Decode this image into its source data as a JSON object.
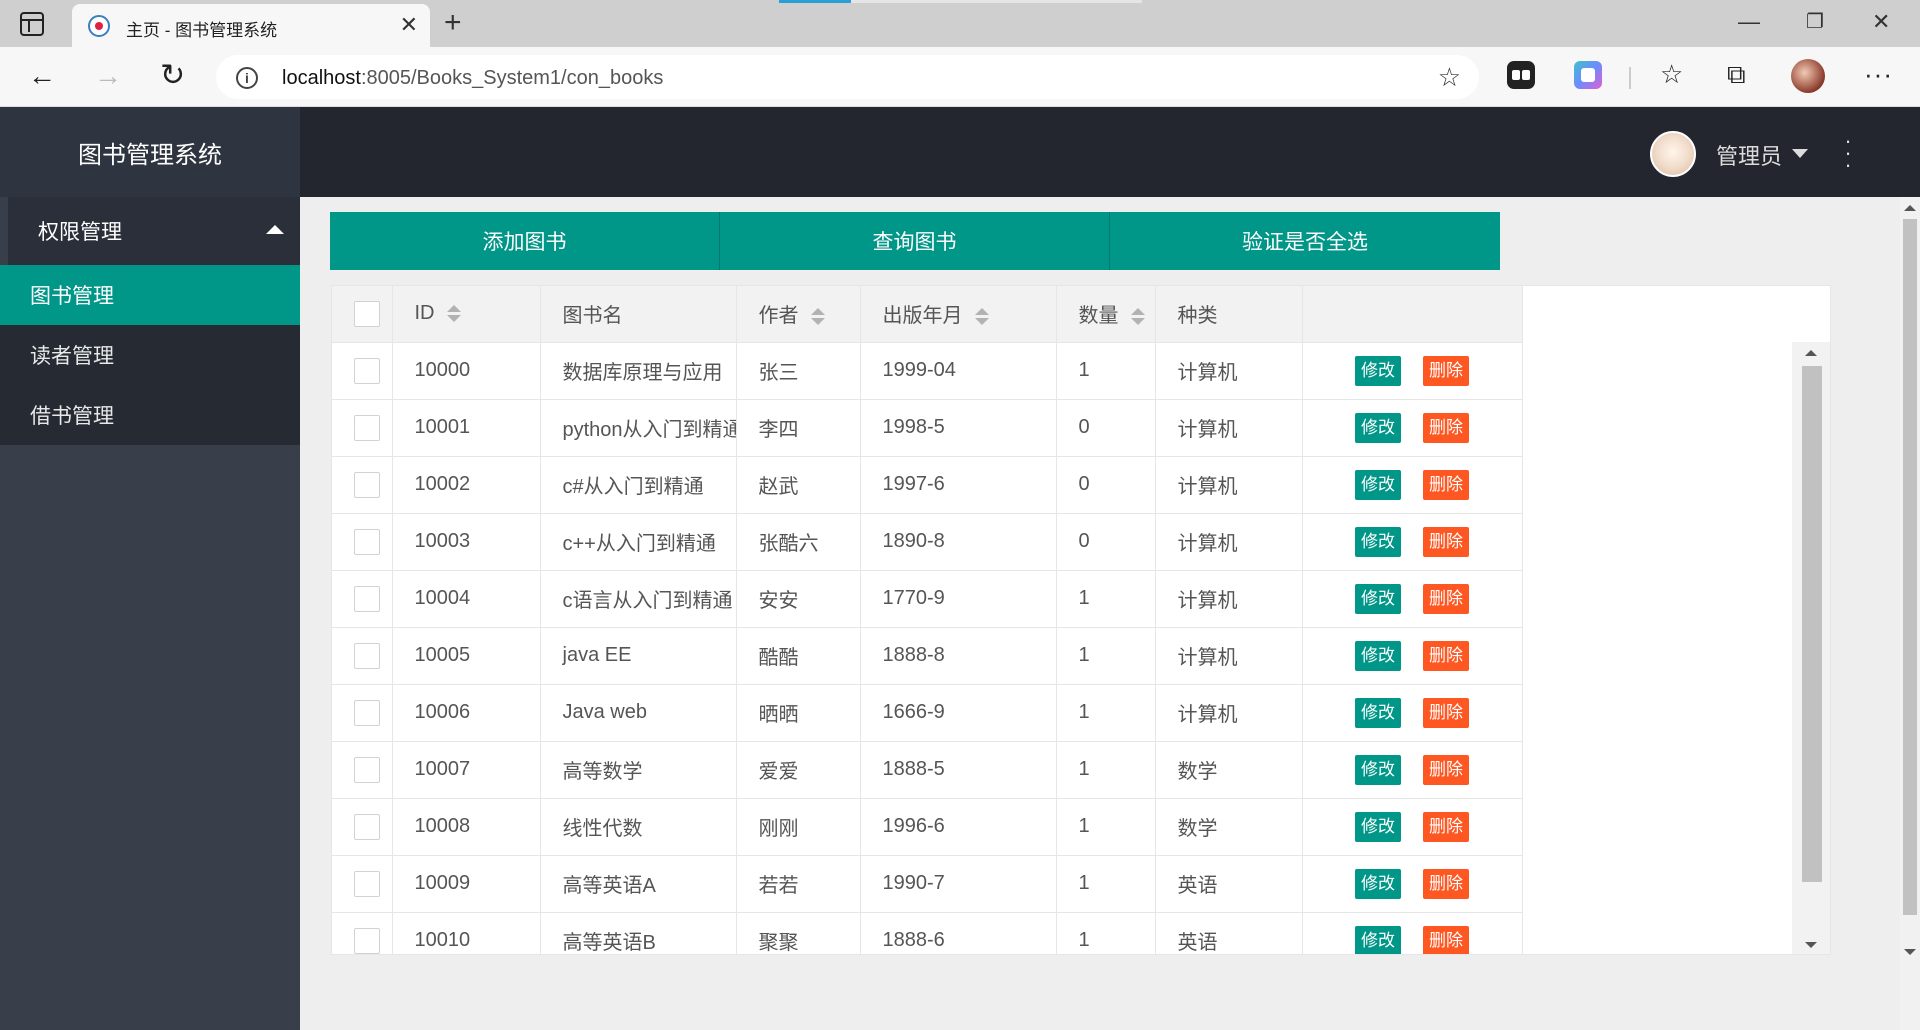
{
  "browser": {
    "tab_title": "主页 - 图书管理系统",
    "url_host": "localhost",
    "url_rest": ":8005/Books_System1/con_books"
  },
  "app": {
    "title": "图书管理系统",
    "user": "管理员"
  },
  "sidebar": {
    "group_label": "权限管理",
    "items": [
      {
        "label": "图书管理",
        "active": true
      },
      {
        "label": "读者管理",
        "active": false
      },
      {
        "label": "借书管理",
        "active": false
      }
    ]
  },
  "toolbar": {
    "add_label": "添加图书",
    "query_label": "查询图书",
    "check_label": "验证是否全选"
  },
  "table": {
    "headers": [
      "ID",
      "图书名",
      "作者",
      "出版年月",
      "数量",
      "种类"
    ],
    "edit_label": "修改",
    "delete_label": "删除",
    "rows": [
      [
        "10000",
        "数据库原理与应用",
        "张三",
        "1999-04",
        "1",
        "计算机"
      ],
      [
        "10001",
        "python从入门到精通",
        "李四",
        "1998-5",
        "0",
        "计算机"
      ],
      [
        "10002",
        "c#从入门到精通",
        "赵武",
        "1997-6",
        "0",
        "计算机"
      ],
      [
        "10003",
        "c++从入门到精通",
        "张酷六",
        "1890-8",
        "0",
        "计算机"
      ],
      [
        "10004",
        "c语言从入门到精通",
        "安安",
        "1770-9",
        "1",
        "计算机"
      ],
      [
        "10005",
        "java EE",
        "酷酷",
        "1888-8",
        "1",
        "计算机"
      ],
      [
        "10006",
        "Java web",
        "晒晒",
        "1666-9",
        "1",
        "计算机"
      ],
      [
        "10007",
        "高等数学",
        "爱爱",
        "1888-5",
        "1",
        "数学"
      ],
      [
        "10008",
        "线性代数",
        "刚刚",
        "1996-6",
        "1",
        "数学"
      ],
      [
        "10009",
        "高等英语A",
        "若若",
        "1990-7",
        "1",
        "英语"
      ],
      [
        "10010",
        "高等英语B",
        "聚聚",
        "1888-6",
        "1",
        "英语"
      ]
    ]
  },
  "colors": {
    "primary": "#009688",
    "danger": "#ff5722",
    "sidebar": "#383f4b",
    "header": "#23262e"
  }
}
